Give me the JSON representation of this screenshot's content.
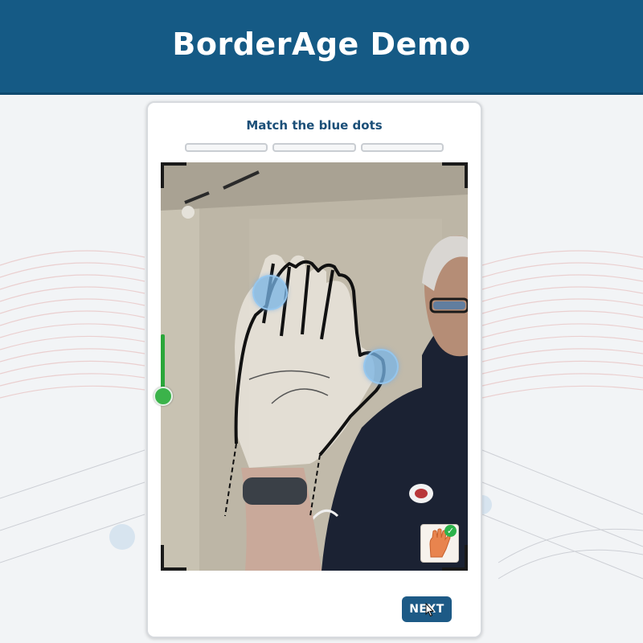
{
  "header": {
    "title": "BorderAge Demo"
  },
  "card": {
    "instruction": "Match the blue dots",
    "progress_segments": 3,
    "next_label": "NEXT"
  },
  "icons": {
    "hand_thumbnail": "hand-icon",
    "check_badge": "check-icon",
    "cursor": "pointer-cursor-icon"
  },
  "colors": {
    "header_bg": "#155a85",
    "title_text": "#1b4f78",
    "dot": "#78b4e6",
    "slider": "#2aa63a",
    "next_button": "#1d5a86"
  }
}
